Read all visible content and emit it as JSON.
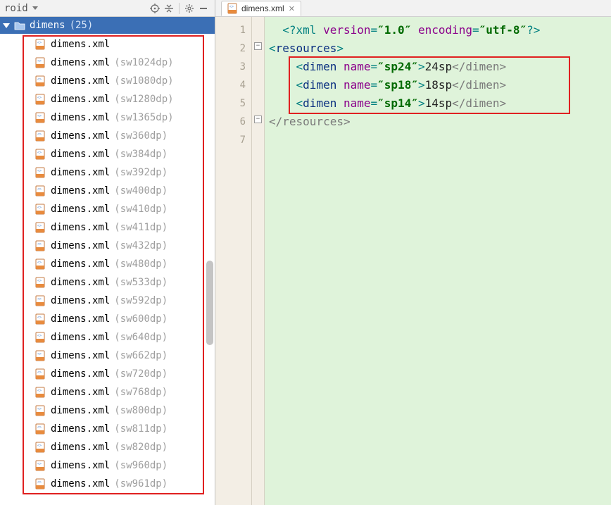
{
  "panel": {
    "viewLabel": "roid",
    "folderName": "dimens",
    "folderCount": "(25)",
    "items": [
      {
        "file": "dimens.xml",
        "qual": ""
      },
      {
        "file": "dimens.xml",
        "qual": "(sw1024dp)"
      },
      {
        "file": "dimens.xml",
        "qual": "(sw1080dp)"
      },
      {
        "file": "dimens.xml",
        "qual": "(sw1280dp)"
      },
      {
        "file": "dimens.xml",
        "qual": "(sw1365dp)"
      },
      {
        "file": "dimens.xml",
        "qual": "(sw360dp)"
      },
      {
        "file": "dimens.xml",
        "qual": "(sw384dp)"
      },
      {
        "file": "dimens.xml",
        "qual": "(sw392dp)"
      },
      {
        "file": "dimens.xml",
        "qual": "(sw400dp)"
      },
      {
        "file": "dimens.xml",
        "qual": "(sw410dp)"
      },
      {
        "file": "dimens.xml",
        "qual": "(sw411dp)"
      },
      {
        "file": "dimens.xml",
        "qual": "(sw432dp)"
      },
      {
        "file": "dimens.xml",
        "qual": "(sw480dp)"
      },
      {
        "file": "dimens.xml",
        "qual": "(sw533dp)"
      },
      {
        "file": "dimens.xml",
        "qual": "(sw592dp)"
      },
      {
        "file": "dimens.xml",
        "qual": "(sw600dp)"
      },
      {
        "file": "dimens.xml",
        "qual": "(sw640dp)"
      },
      {
        "file": "dimens.xml",
        "qual": "(sw662dp)"
      },
      {
        "file": "dimens.xml",
        "qual": "(sw720dp)"
      },
      {
        "file": "dimens.xml",
        "qual": "(sw768dp)"
      },
      {
        "file": "dimens.xml",
        "qual": "(sw800dp)"
      },
      {
        "file": "dimens.xml",
        "qual": "(sw811dp)"
      },
      {
        "file": "dimens.xml",
        "qual": "(sw820dp)"
      },
      {
        "file": "dimens.xml",
        "qual": "(sw960dp)"
      },
      {
        "file": "dimens.xml",
        "qual": "(sw961dp)"
      }
    ]
  },
  "tab": {
    "label": "dimens.xml"
  },
  "code": {
    "xmlVersion": "1.0",
    "xmlEncoding": "utf-8",
    "rootTag": "resources",
    "dimenTag": "dimen",
    "nameAttr": "name",
    "dimens": [
      {
        "name": "sp24",
        "value": "24sp"
      },
      {
        "name": "sp18",
        "value": "18sp"
      },
      {
        "name": "sp14",
        "value": "14sp"
      }
    ],
    "lineNumbers": [
      "1",
      "2",
      "3",
      "4",
      "5",
      "6",
      "7"
    ]
  },
  "tokens": {
    "xmlOpen": "<?xml ",
    "versionWord": "version",
    "encodingWord": " encoding",
    "eq": "=",
    "q": "″",
    "xmlClose": "?>",
    "lt": "<",
    "gt": ">",
    "ltSlash": "</",
    "space": " "
  }
}
